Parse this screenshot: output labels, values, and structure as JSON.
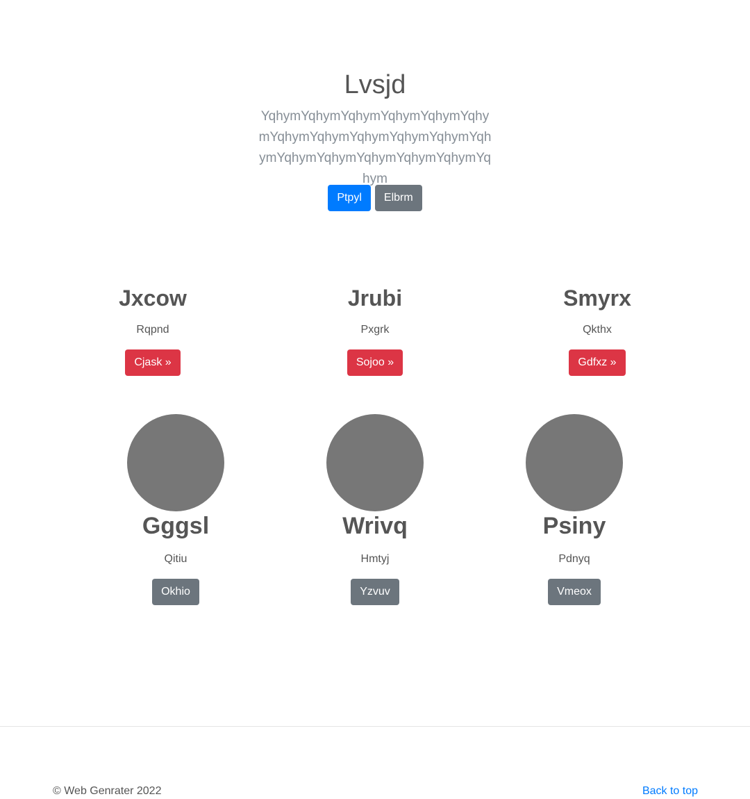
{
  "hero": {
    "title": "Lvsjd",
    "lead": "YqhymYqhymYqhymYqhymYqhymYqhymYqhymYqhymYqhymYqhymYqhymYqhymYqhymYqhymYqhymYqhymYqhymYqhym",
    "primary_button": "Ptpyl",
    "secondary_button": "Elbrm"
  },
  "features": [
    {
      "title": "Jxcow",
      "text": "Rqpnd",
      "button": "Cjask »"
    },
    {
      "title": "Jrubi",
      "text": "Pxgrk",
      "button": "Sojoo »"
    },
    {
      "title": "Smyrx",
      "text": "Qkthx",
      "button": "Gdfxz »"
    }
  ],
  "people": [
    {
      "name": "Gggsl",
      "text": "Qitiu",
      "button": "Okhio"
    },
    {
      "name": "Wrivq",
      "text": "Hmtyj",
      "button": "Yzvuv"
    },
    {
      "name": "Psiny",
      "text": "Pdnyq",
      "button": "Vmeox"
    }
  ],
  "footer": {
    "copyright": "© Web Genrater 2022",
    "back_to_top": "Back to top"
  },
  "colors": {
    "primary": "#007bff",
    "secondary": "#6c757d",
    "danger": "#dc3545",
    "avatar": "#777777"
  }
}
